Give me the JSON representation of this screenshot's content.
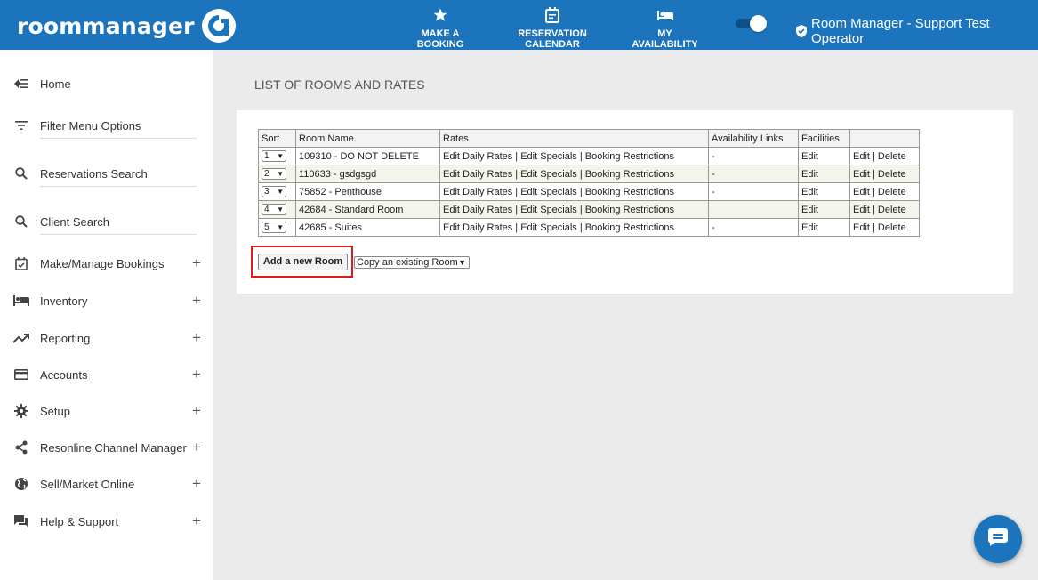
{
  "brand": {
    "name": "roommanager",
    "color": "#1c75bc"
  },
  "topnav": [
    {
      "label": "MAKE A BOOKING",
      "icon": "star-icon"
    },
    {
      "label": "RESERVATION CALENDAR",
      "icon": "calendar-icon"
    },
    {
      "label": "MY AVAILABILITY",
      "icon": "bed-icon"
    }
  ],
  "toggle": {
    "on": true
  },
  "user": {
    "name": "Room Manager - Support Test Operator",
    "icon": "shield-check-icon"
  },
  "sidebar": {
    "items": [
      {
        "label": "Home",
        "icon": "back-arrow-icon",
        "expandable": false
      },
      {
        "label": "Filter Menu Options",
        "icon": "filter-icon",
        "expandable": false
      },
      {
        "label": "Reservations Search",
        "icon": "search-icon",
        "expandable": false
      },
      {
        "label": "Client Search",
        "icon": "search-icon",
        "expandable": false
      },
      {
        "label": "Make/Manage Bookings",
        "icon": "calendar-check-icon",
        "expandable": true
      },
      {
        "label": "Inventory",
        "icon": "bed-icon",
        "expandable": true
      },
      {
        "label": "Reporting",
        "icon": "trending-icon",
        "expandable": true
      },
      {
        "label": "Accounts",
        "icon": "card-icon",
        "expandable": true
      },
      {
        "label": "Setup",
        "icon": "gear-icon",
        "expandable": true
      },
      {
        "label": "Resonline Channel Manager",
        "icon": "share-icon",
        "expandable": true
      },
      {
        "label": "Sell/Market Online",
        "icon": "globe-icon",
        "expandable": true
      },
      {
        "label": "Help & Support",
        "icon": "chat-bubbles-icon",
        "expandable": true
      }
    ],
    "plus_symbol": "+"
  },
  "main": {
    "title": "LIST OF ROOMS AND RATES",
    "table": {
      "headers": [
        "Sort",
        "Room Name",
        "Rates",
        "Availability Links",
        "Facilities",
        ""
      ],
      "rows": [
        {
          "sort": "1",
          "name": "109310 - DO NOT DELETE",
          "rates": "Edit Daily Rates | Edit Specials | Booking Restrictions",
          "availability": "-",
          "facilities": "Edit",
          "actions": "Edit | Delete"
        },
        {
          "sort": "2",
          "name": "110633 - gsdgsgd",
          "rates": "Edit Daily Rates | Edit Specials | Booking Restrictions",
          "availability": "-",
          "facilities": "Edit",
          "actions": "Edit | Delete"
        },
        {
          "sort": "3",
          "name": "75852 - Penthouse",
          "rates": "Edit Daily Rates | Edit Specials | Booking Restrictions",
          "availability": "-",
          "facilities": "Edit",
          "actions": "Edit | Delete"
        },
        {
          "sort": "4",
          "name": "42684 - Standard Room",
          "rates": "Edit Daily Rates | Edit Specials | Booking Restrictions",
          "availability": "",
          "facilities": "Edit",
          "actions": "Edit | Delete"
        },
        {
          "sort": "5",
          "name": "42685 - Suites",
          "rates": "Edit Daily Rates | Edit Specials | Booking Restrictions",
          "availability": "-",
          "facilities": "Edit",
          "actions": "Edit | Delete"
        }
      ]
    },
    "add_button": "Add a new Room",
    "copy_select": "Copy an existing Room",
    "highlight_color": "#e0191b"
  },
  "chat_button": {
    "icon": "chat-icon"
  }
}
